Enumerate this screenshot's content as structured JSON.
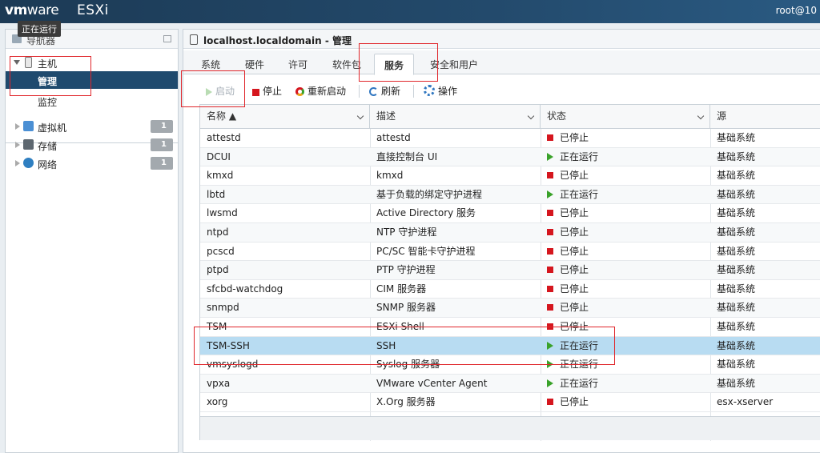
{
  "topbar": {
    "logo_vm": "vm",
    "logo_ware": "ware",
    "logo_esxi": "ESXi",
    "user": "root@10",
    "tooltip": "正在运行"
  },
  "navigator": {
    "title": "导航器",
    "host": "主机",
    "manage": "管理",
    "monitor": "监控",
    "items": [
      {
        "label": "虚拟机",
        "count": "1",
        "icon": "vm-icon"
      },
      {
        "label": "存储",
        "count": "1",
        "icon": "storage-icon"
      },
      {
        "label": "网络",
        "count": "1",
        "icon": "network-icon"
      }
    ]
  },
  "main": {
    "title": "localhost.localdomain - 管理",
    "tabs": [
      "系统",
      "硬件",
      "许可",
      "软件包",
      "服务",
      "安全和用户"
    ],
    "active_tab": "服务",
    "toolbar": {
      "start": "启动",
      "stop": "停止",
      "restart": "重新启动",
      "refresh": "刷新",
      "actions": "操作"
    },
    "columns": {
      "name": "名称 ▲",
      "desc": "描述",
      "status": "状态",
      "source": "源"
    },
    "rows": [
      {
        "name": "attestd",
        "desc": "attestd",
        "status": "已停止",
        "running": false,
        "source": "基础系统"
      },
      {
        "name": "DCUI",
        "desc": "直接控制台 UI",
        "status": "正在运行",
        "running": true,
        "source": "基础系统"
      },
      {
        "name": "kmxd",
        "desc": "kmxd",
        "status": "已停止",
        "running": false,
        "source": "基础系统"
      },
      {
        "name": "lbtd",
        "desc": "基于负载的绑定守护进程",
        "status": "正在运行",
        "running": true,
        "source": "基础系统"
      },
      {
        "name": "lwsmd",
        "desc": "Active Directory 服务",
        "status": "已停止",
        "running": false,
        "source": "基础系统"
      },
      {
        "name": "ntpd",
        "desc": "NTP 守护进程",
        "status": "已停止",
        "running": false,
        "source": "基础系统"
      },
      {
        "name": "pcscd",
        "desc": "PC/SC 智能卡守护进程",
        "status": "已停止",
        "running": false,
        "source": "基础系统"
      },
      {
        "name": "ptpd",
        "desc": "PTP 守护进程",
        "status": "已停止",
        "running": false,
        "source": "基础系统"
      },
      {
        "name": "sfcbd-watchdog",
        "desc": "CIM 服务器",
        "status": "已停止",
        "running": false,
        "source": "基础系统"
      },
      {
        "name": "snmpd",
        "desc": "SNMP 服务器",
        "status": "已停止",
        "running": false,
        "source": "基础系统"
      },
      {
        "name": "TSM",
        "desc": "ESXi Shell",
        "status": "已停止",
        "running": false,
        "source": "基础系统"
      },
      {
        "name": "TSM-SSH",
        "desc": "SSH",
        "status": "正在运行",
        "running": true,
        "source": "基础系统",
        "selected": true
      },
      {
        "name": "vmsyslogd",
        "desc": "Syslog 服务器",
        "status": "正在运行",
        "running": true,
        "source": "基础系统"
      },
      {
        "name": "vpxa",
        "desc": "VMware vCenter Agent",
        "status": "正在运行",
        "running": true,
        "source": "基础系统"
      },
      {
        "name": "xorg",
        "desc": "X.Org 服务器",
        "status": "已停止",
        "running": false,
        "source": "esx-xserver"
      }
    ]
  },
  "colors": {
    "selected_row": "#b8dcf2",
    "nav_selected": "#1f4a6e",
    "stopped": "#d5161e",
    "running": "#3aa22a",
    "annotation": "#e0262b"
  }
}
